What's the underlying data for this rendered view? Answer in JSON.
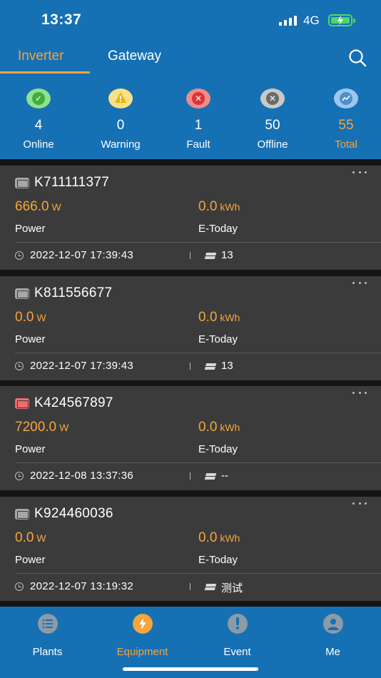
{
  "status_bar": {
    "time": "13:37",
    "network": "4G"
  },
  "tabs": [
    {
      "label": "Inverter",
      "active": true
    },
    {
      "label": "Gateway",
      "active": false
    }
  ],
  "stats": [
    {
      "label": "Online",
      "count": "4",
      "icon": "check-icon",
      "color": "#5cc05c"
    },
    {
      "label": "Warning",
      "count": "0",
      "icon": "warning-icon",
      "color": "#f0c419"
    },
    {
      "label": "Fault",
      "count": "1",
      "icon": "x-icon",
      "color": "#e95454"
    },
    {
      "label": "Offline",
      "count": "50",
      "icon": "x-icon",
      "color": "#8a8a8a"
    },
    {
      "label": "Total",
      "count": "55",
      "icon": "chart-icon",
      "color": "#5a9fd6",
      "highlight": "#f5a53c"
    }
  ],
  "devices": [
    {
      "sn": "K711111377",
      "power_value": "666.0",
      "power_unit": "W",
      "power_label": "Power",
      "etoday_value": "0.0",
      "etoday_unit": "kWh",
      "etoday_label": "E-Today",
      "time": "2022-12-07 17:39:43",
      "plant": "13",
      "alert": false
    },
    {
      "sn": "K811556677",
      "power_value": "0.0",
      "power_unit": "W",
      "power_label": "Power",
      "etoday_value": "0.0",
      "etoday_unit": "kWh",
      "etoday_label": "E-Today",
      "time": "2022-12-07 17:39:43",
      "plant": "13",
      "alert": false
    },
    {
      "sn": "K424567897",
      "power_value": "7200.0",
      "power_unit": "W",
      "power_label": "Power",
      "etoday_value": "0.0",
      "etoday_unit": "kWh",
      "etoday_label": "E-Today",
      "time": "2022-12-08 13:37:36",
      "plant": "--",
      "alert": true
    },
    {
      "sn": "K924460036",
      "power_value": "0.0",
      "power_unit": "W",
      "power_label": "Power",
      "etoday_value": "0.0",
      "etoday_unit": "kWh",
      "etoday_label": "E-Today",
      "time": "2022-12-07 13:19:32",
      "plant": "测试",
      "alert": false
    }
  ],
  "bottom_nav": [
    {
      "label": "Plants",
      "icon": "list-icon",
      "active": false
    },
    {
      "label": "Equipment",
      "icon": "lightning-icon",
      "active": true
    },
    {
      "label": "Event",
      "icon": "exclamation-icon",
      "active": false
    },
    {
      "label": "Me",
      "icon": "person-icon",
      "active": false
    }
  ],
  "colors": {
    "header_bg": "#1670b4",
    "accent": "#f5a53c",
    "card_bg": "#3b3b3b",
    "page_bg": "#141414",
    "inactive_nav_icon": "#8e9aa6"
  }
}
